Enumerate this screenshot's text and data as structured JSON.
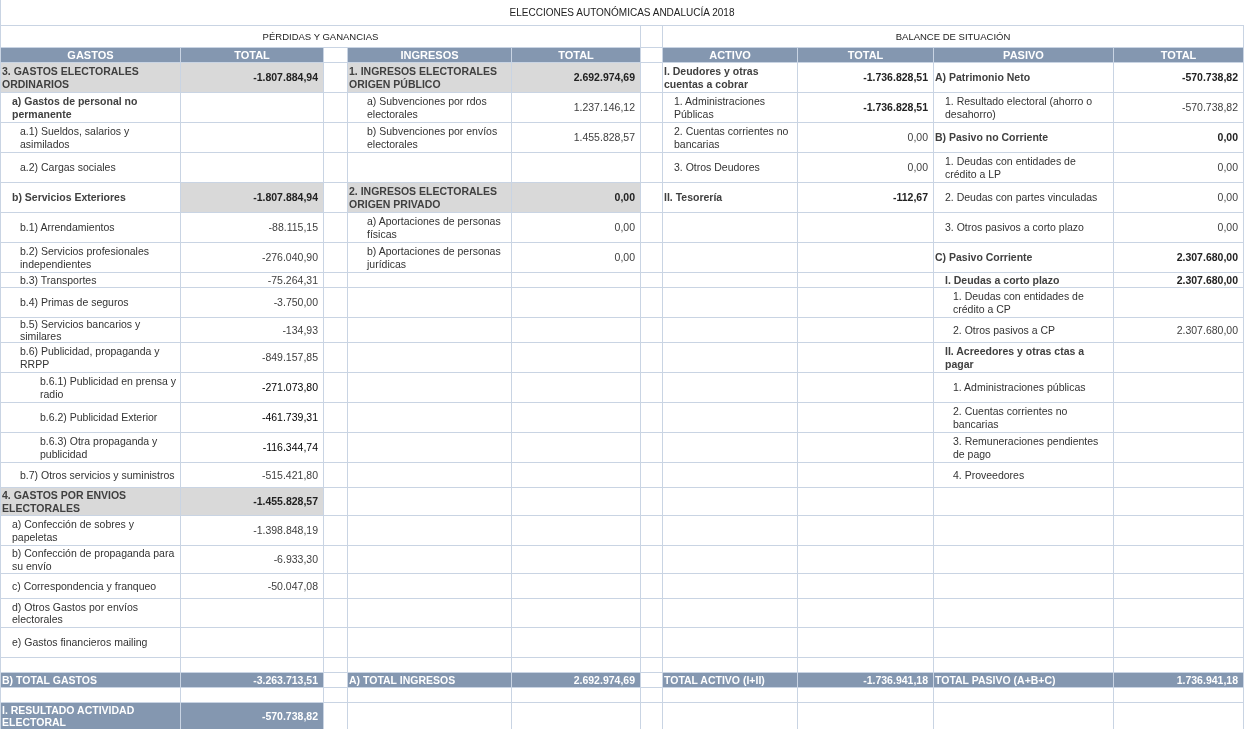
{
  "title": "ELECCIONES AUTONÓMICAS ANDALUCÍA 2018",
  "sections": [
    "PÉRDIDAS Y GANANCIAS",
    "BALANCE DE SITUACIÓN"
  ],
  "headers": [
    "GASTOS",
    "TOTAL",
    "INGRESOS",
    "TOTAL",
    "ACTIVO",
    "TOTAL",
    "PASIVO",
    "TOTAL"
  ],
  "rows": [
    {
      "gastos": {
        "kind": "group",
        "label": "3. GASTOS ELECTORALES ORDINARIOS",
        "total": "-1.807.884,94"
      },
      "ingresos": {
        "kind": "group",
        "label": "1. INGRESOS ELECTORALES ORIGEN PÚBLICO",
        "total": "2.692.974,69"
      },
      "activo": {
        "kind": "head",
        "label": "I. Deudores y otras cuentas a cobrar",
        "total": "-1.736.828,51"
      },
      "pasivo": {
        "kind": "head",
        "label": "A) Patrimonio Neto",
        "total": "-570.738,82"
      }
    },
    {
      "gastos": {
        "kind": "title",
        "label": "a) Gastos de personal no permanente"
      },
      "ingresos": {
        "kind": "entry",
        "label": "a) Subvenciones por rdos electorales",
        "total": "1.237.146,12"
      },
      "activo": {
        "kind": "line_strong",
        "label": "1. Administraciones Públicas",
        "total": "-1.736.828,51"
      },
      "pasivo": {
        "kind": "line",
        "label": "1. Resultado electoral (ahorro o desahorro)",
        "total": "-570.738,82"
      }
    },
    {
      "gastos": {
        "kind": "entry",
        "label": "a.1) Sueldos, salarios y asimilados"
      },
      "ingresos": {
        "kind": "entry",
        "label": "b) Subvenciones por envíos electorales",
        "total": "1.455.828,57"
      },
      "activo": {
        "kind": "line",
        "label": "2. Cuentas corrientes no bancarias",
        "total": "0,00"
      },
      "pasivo": {
        "kind": "head",
        "label": "B) Pasivo no Corriente",
        "total": "0,00"
      }
    },
    {
      "gastos": {
        "kind": "entry",
        "label": "a.2) Cargas sociales"
      },
      "activo": {
        "kind": "line",
        "label": "3. Otros Deudores",
        "total": "0,00"
      },
      "pasivo": {
        "kind": "line",
        "label": "1. Deudas con entidades de crédito a LP",
        "total": "0,00"
      }
    },
    {
      "gastos": {
        "kind": "subgroup",
        "label": "b) Servicios Exteriores",
        "total": "-1.807.884,94"
      },
      "ingresos": {
        "kind": "group",
        "label": "2. INGRESOS ELECTORALES ORIGEN PRIVADO",
        "total": "0,00"
      },
      "activo": {
        "kind": "head",
        "label": "II. Tesorería",
        "total": "-112,67"
      },
      "pasivo": {
        "kind": "line",
        "label": "2. Deudas con partes vinculadas",
        "total": "0,00"
      }
    },
    {
      "gastos": {
        "kind": "entry",
        "label": "b.1) Arrendamientos",
        "total": "-88.115,15"
      },
      "ingresos": {
        "kind": "entry",
        "label": "a) Aportaciones de personas físicas",
        "total": "0,00"
      },
      "pasivo": {
        "kind": "line",
        "label": "3. Otros pasivos a corto plazo",
        "total": "0,00"
      }
    },
    {
      "gastos": {
        "kind": "entry",
        "label": "b.2) Servicios profesionales independientes",
        "total": "-276.040,90"
      },
      "ingresos": {
        "kind": "entry",
        "label": "b) Aportaciones de personas jurídicas",
        "total": "0,00"
      },
      "pasivo": {
        "kind": "head",
        "label": "C) Pasivo Corriente",
        "total": "2.307.680,00"
      }
    },
    {
      "gastos": {
        "kind": "entry",
        "label": "b.3) Transportes",
        "total": "-75.264,31"
      },
      "pasivo": {
        "kind": "title",
        "label": "I. Deudas a corto plazo",
        "total": "2.307.680,00"
      }
    },
    {
      "gastos": {
        "kind": "entry",
        "label": "b.4) Primas de seguros",
        "total": "-3.750,00"
      },
      "pasivo": {
        "kind": "entry",
        "label": "1. Deudas con entidades de crédito a CP"
      }
    },
    {
      "gastos": {
        "kind": "entry",
        "label": "b.5) Servicios bancarios y similares",
        "total": "-134,93"
      },
      "pasivo": {
        "kind": "entry",
        "label": "2. Otros pasivos a CP",
        "total": "2.307.680,00"
      }
    },
    {
      "gastos": {
        "kind": "entry",
        "label": "b.6) Publicidad, propaganda y RRPP",
        "total": "-849.157,85"
      },
      "pasivo": {
        "kind": "title",
        "label": "II. Acreedores y otras ctas a pagar"
      }
    },
    {
      "gastos": {
        "kind": "detail",
        "label": "b.6.1) Publicidad en prensa y radio",
        "total": "-271.073,80"
      },
      "pasivo": {
        "kind": "entry",
        "label": "1. Administraciones públicas"
      }
    },
    {
      "gastos": {
        "kind": "detail",
        "label": "b.6.2) Publicidad Exterior",
        "total": "-461.739,31"
      },
      "pasivo": {
        "kind": "entry",
        "label": "2. Cuentas corrientes no bancarias"
      }
    },
    {
      "gastos": {
        "kind": "detail",
        "label": "b.6.3) Otra propaganda y publicidad",
        "total": "-116.344,74"
      },
      "pasivo": {
        "kind": "entry",
        "label": "3. Remuneraciones pendientes de pago"
      }
    },
    {
      "gastos": {
        "kind": "entry",
        "label": "b.7) Otros servicios y suministros",
        "total": "-515.421,80"
      },
      "pasivo": {
        "kind": "entry",
        "label": "4. Proveedores"
      }
    },
    {
      "gastos": {
        "kind": "group",
        "label": "4. GASTOS POR ENVIOS ELECTORALES",
        "total": "-1.455.828,57"
      }
    },
    {
      "gastos": {
        "kind": "line",
        "label": "a) Confección de sobres y papeletas",
        "total": "-1.398.848,19"
      }
    },
    {
      "gastos": {
        "kind": "line",
        "label": "b) Confección de propaganda para su envío",
        "total": "-6.933,30"
      }
    },
    {
      "gastos": {
        "kind": "line",
        "label": "c) Correspondencia y franqueo",
        "total": "-50.047,08"
      }
    },
    {
      "gastos": {
        "kind": "line",
        "label": "d) Otros Gastos por envíos electorales"
      }
    },
    {
      "gastos": {
        "kind": "line",
        "label": "e) Gastos financieros mailing"
      }
    }
  ],
  "totals": {
    "gastos": {
      "kind": "total",
      "label": "B) TOTAL GASTOS",
      "total": "-3.263.713,51"
    },
    "ingresos": {
      "kind": "total",
      "label": "A) TOTAL INGRESOS",
      "total": "2.692.974,69"
    },
    "activo": {
      "kind": "total",
      "label": "TOTAL ACTIVO (I+II)",
      "total": "-1.736.941,18"
    },
    "pasivo": {
      "kind": "total",
      "label": "TOTAL PASIVO (A+B+C)",
      "total": "1.736.941,18"
    }
  },
  "result": {
    "gastos": {
      "kind": "total",
      "label": "I. RESULTADO ACTIVIDAD ELECTORAL",
      "total": "-570.738,82"
    }
  }
}
